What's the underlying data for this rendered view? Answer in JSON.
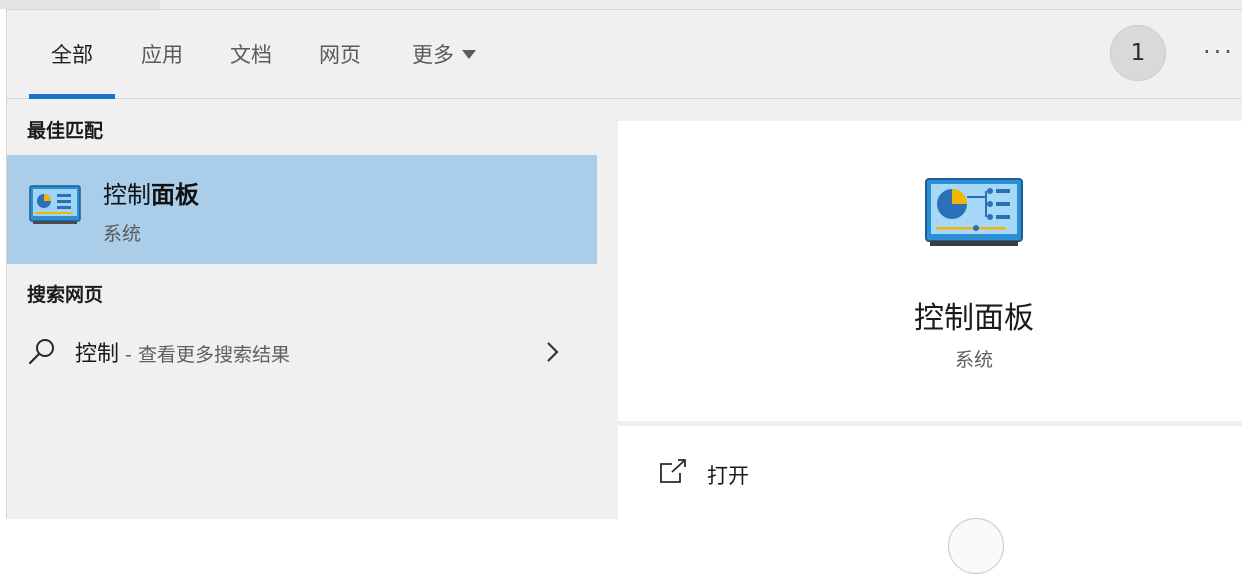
{
  "tabs": [
    {
      "label": "全部",
      "active": true
    },
    {
      "label": "应用"
    },
    {
      "label": "文档"
    },
    {
      "label": "网页"
    },
    {
      "label": "更多"
    }
  ],
  "header": {
    "badge": "1",
    "more_icon": "ellipsis-icon"
  },
  "sections": {
    "best_match": "最佳匹配",
    "web_search": "搜索网页"
  },
  "best_match": {
    "title_prefix": "控制",
    "title_suffix": "面板",
    "subtitle": "系统",
    "icon": "control-panel-icon"
  },
  "web_result": {
    "query": "控制",
    "hint": " - 查看更多搜索结果",
    "icon": "search-icon",
    "chevron": "chevron-right-icon"
  },
  "preview": {
    "name": "控制面板",
    "type": "系统"
  },
  "actions": [
    {
      "label": "打开",
      "icon": "open-icon"
    }
  ],
  "colors": {
    "accent": "#1a73c8",
    "selection": "#aacde9"
  }
}
